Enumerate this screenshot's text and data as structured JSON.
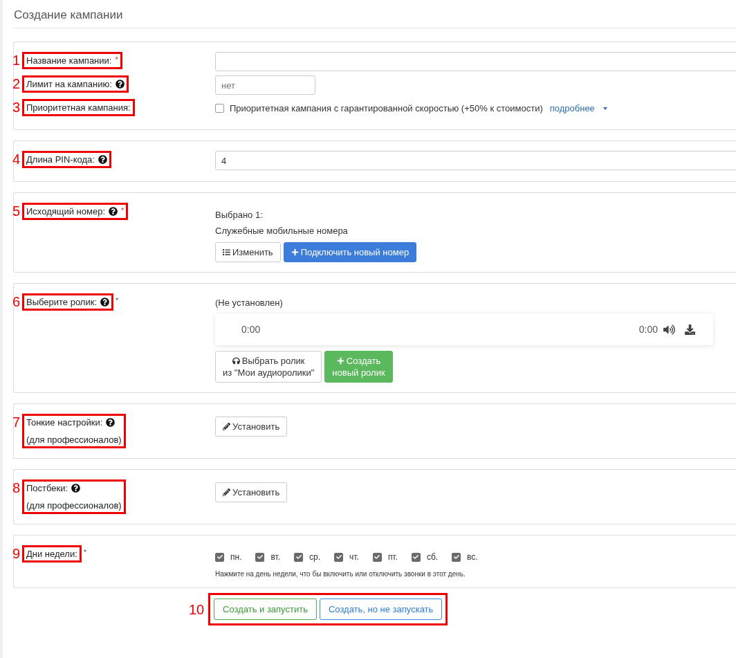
{
  "title": "Создание кампании",
  "cards": [
    {
      "rows": [
        {
          "marker": "1",
          "label": "Название кампании:",
          "help": false,
          "required": "*",
          "control": {
            "kind": "input"
          }
        },
        {
          "marker": "2",
          "label": "Лимит на кампанию:",
          "help": true,
          "control": {
            "kind": "short_input",
            "placeholder": "нет"
          }
        },
        {
          "marker": "3",
          "label": "Приоритетная кампания:",
          "help": false,
          "control": {
            "kind": "checkbox",
            "checked": false,
            "text": "Приоритетная кампания с гарантированной скоростью (+50% к стоимости)",
            "link": "подробнее"
          }
        }
      ]
    },
    {
      "rows": [
        {
          "marker": "4",
          "label": "Длина PIN-кода:",
          "help": true,
          "control": {
            "kind": "input",
            "value": "4"
          }
        }
      ]
    },
    {
      "rows": [
        {
          "marker": "5",
          "label": "Исходящий номер:",
          "help": true,
          "required": "*",
          "control": {
            "kind": "selection",
            "lines": [
              "Выбрано 1:",
              "Служебные мобильные номера"
            ],
            "buttons": [
              {
                "lines": [
                  "Изменить"
                ]
              },
              {
                "lines": [
                  "Подключить новый номер"
                ]
              }
            ]
          }
        }
      ]
    },
    {
      "rows": [
        {
          "marker": "6",
          "label": "Выберите ролик:",
          "help": true,
          "required": "*",
          "required_outside": true,
          "control": {
            "kind": "audio",
            "status": "(Не установлен)",
            "current": "0:00",
            "duration": "0:00",
            "buttons": [
              {
                "lines": [
                  "Выбрать ролик",
                  "из \"Мои аудиоролики\""
                ]
              },
              {
                "lines": [
                  "Создать",
                  "новый ролик"
                ]
              }
            ]
          }
        }
      ]
    },
    {
      "rows": [
        {
          "marker": "7",
          "label": "Тонкие настройки:",
          "sublabel": "(для профессионалов)",
          "help": true,
          "control": {
            "kind": "button",
            "button": {
              "lines": [
                "Установить"
              ]
            }
          }
        }
      ]
    },
    {
      "rows": [
        {
          "marker": "8",
          "label": "Постбеки:",
          "sublabel": "(для профессионалов)",
          "help": true,
          "control": {
            "kind": "button",
            "button": {
              "lines": [
                "Установить"
              ]
            }
          }
        }
      ]
    },
    {
      "rows": [
        {
          "marker": "9",
          "label": "Дни недели:",
          "help": false,
          "required": "*",
          "required_outside": true,
          "control": {
            "kind": "days",
            "days": [
              {
                "label": "пн.",
                "checked": true
              },
              {
                "label": "вт.",
                "checked": true
              },
              {
                "label": "ср.",
                "checked": true
              },
              {
                "label": "чт.",
                "checked": true
              },
              {
                "label": "пт.",
                "checked": true
              },
              {
                "label": "сб.",
                "checked": true
              },
              {
                "label": "вс.",
                "checked": true
              }
            ],
            "hint": "Нажмите на день недели, что бы включить или отключить звонки в этот день."
          }
        }
      ]
    }
  ],
  "footer": {
    "marker": "10",
    "buttons": [
      {
        "label": "Создать и запустить"
      },
      {
        "label": "Создать, но не запускать"
      }
    ]
  }
}
